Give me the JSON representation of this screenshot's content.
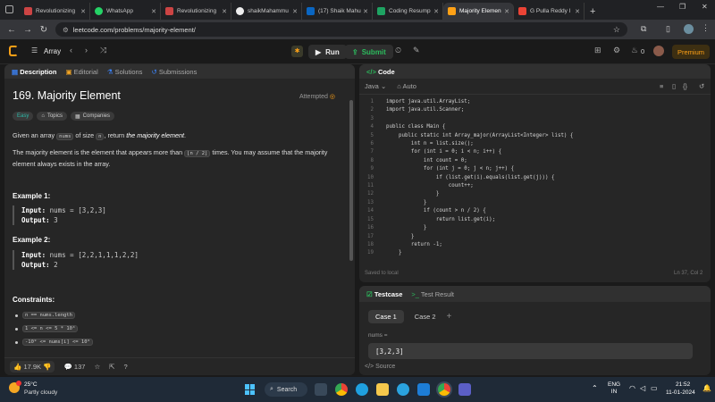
{
  "browser": {
    "tabs": [
      {
        "label": "Revolutionizing",
        "color": "#c44"
      },
      {
        "label": "WhatsApp",
        "color": "#25d366"
      },
      {
        "label": "Revolutionizing",
        "color": "#c44"
      },
      {
        "label": "shaikMahammu",
        "color": "#eee"
      },
      {
        "label": "(17) Shaik Mahu",
        "color": "#0a66c2"
      },
      {
        "label": "Coding Resump",
        "color": "#1ea362"
      },
      {
        "label": "Majority Elemen",
        "color": "#ffa116"
      },
      {
        "label": "G Pulla Reddy I",
        "color": "#ea4335"
      }
    ],
    "new_tab": "+",
    "url": "leetcode.com/problems/majority-element/"
  },
  "lc": {
    "list_label": "Array",
    "run_label": "Run",
    "submit_label": "Submit",
    "streak": "0",
    "premium_label": "Premium"
  },
  "left": {
    "tabs": [
      "Description",
      "Editorial",
      "Solutions",
      "Submissions"
    ],
    "title": "169. Majority Element",
    "status": "Attempted",
    "badges": [
      "Easy",
      "Topics",
      "Companies"
    ],
    "desc1_pre": "Given an array",
    "desc1_code1": "nums",
    "desc1_mid": "of size",
    "desc1_code2": "n",
    "desc1_post": ", return",
    "desc1_em": "the majority element",
    "desc2_pre": "The majority element is the element that appears more than",
    "desc2_code": "⌊n / 2⌋",
    "desc2_post": "times. You may assume that the majority element always exists in the array.",
    "ex1_title": "Example 1:",
    "ex1_input_label": "Input:",
    "ex1_input": "nums = [3,2,3]",
    "ex1_output_label": "Output:",
    "ex1_output": "3",
    "ex2_title": "Example 2:",
    "ex2_input_label": "Input:",
    "ex2_input": "nums = [2,2,1,1,1,2,2]",
    "ex2_output_label": "Output:",
    "ex2_output": "2",
    "constraints_title": "Constraints:",
    "constraints": [
      "n == nums.length",
      "1 <= n <= 5 * 10⁴",
      "-10⁹ <= nums[i] <= 10⁹"
    ],
    "likes": "17.9K",
    "comments": "137"
  },
  "code": {
    "title": "Code",
    "language": "Java",
    "mode": "Auto",
    "lines": [
      "import java.util.ArrayList;",
      "import java.util.Scanner;",
      "",
      "public class Main {",
      "    public static int Array_major(ArrayList<Integer> list) {",
      "        int n = list.size();",
      "        for (int i = 0; i < n; i++) {",
      "            int count = 0;",
      "            for (int j = 0; j < n; j++) {",
      "                if (list.get(i).equals(list.get(j))) {",
      "                    count++;",
      "                }",
      "            }",
      "            if (count > n / 2) {",
      "                return list.get(i);",
      "            }",
      "        }",
      "        return -1;",
      "    }"
    ],
    "saved": "Saved to local",
    "cursor": "Ln 37, Col 2"
  },
  "testcase": {
    "tabs": [
      "Testcase",
      "Test Result"
    ],
    "cases": [
      "Case 1",
      "Case 2"
    ],
    "add": "+",
    "var_label": "nums =",
    "value": "[3,2,3]",
    "source_label": "Source"
  },
  "taskbar": {
    "temp": "25°C",
    "weather": "Partly cloudy",
    "search": "Search",
    "lang1": "ENG",
    "lang2": "IN",
    "time": "21:52",
    "date": "11-01-2024"
  }
}
